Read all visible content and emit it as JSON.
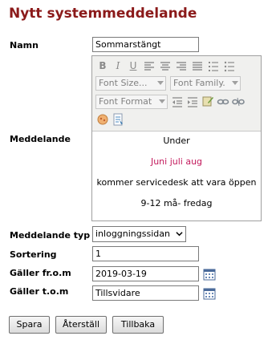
{
  "page": {
    "title": "Nytt systemmeddelande"
  },
  "form": {
    "name_label": "Namn",
    "name_value": "Sommarstängt",
    "message_label": "Meddelande",
    "message_lines": [
      {
        "text": "Under",
        "color": "#000000"
      },
      {
        "text": "Juni juli aug",
        "color": "#c2185b"
      },
      {
        "text": "kommer servicedesk att vara öppen",
        "color": "#000000"
      },
      {
        "text": "9-12 må- fredag",
        "color": "#000000"
      }
    ],
    "type_label": "Meddelande typ",
    "type_value": "inloggningssidan",
    "sort_label": "Sortering",
    "sort_value": "1",
    "from_label": "Gäller fr.o.m",
    "from_value": "2019-03-19",
    "to_label": "Gäller t.o.m",
    "to_value": "Tillsvidare"
  },
  "editor_toolbar": {
    "bold": "B",
    "italic": "I",
    "underline": "U",
    "font_size": "Font Size...",
    "font_family": "Font Family.",
    "font_format": "Font Format"
  },
  "buttons": {
    "save": "Spara",
    "reset": "Återställ",
    "back": "Tillbaka"
  }
}
